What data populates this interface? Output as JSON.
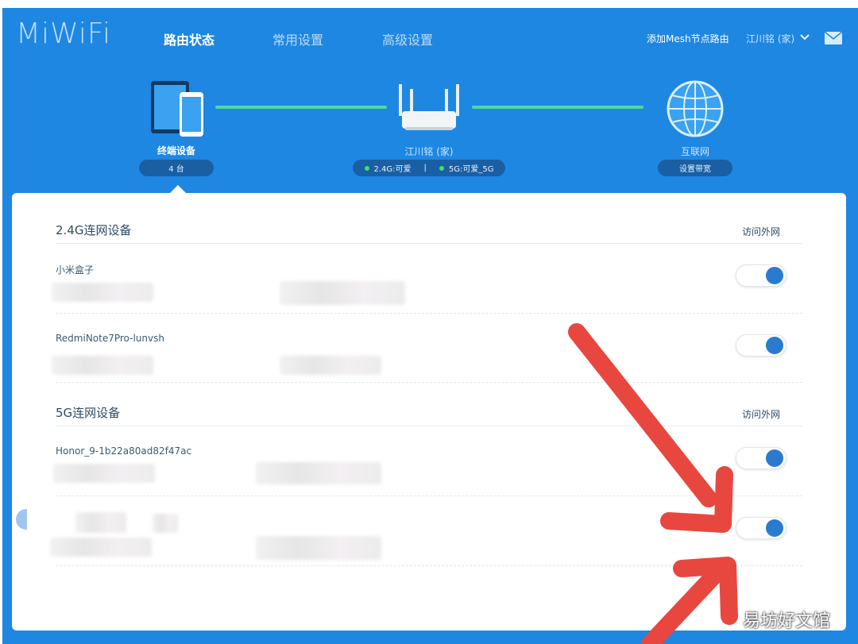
{
  "header": {
    "logo": "MiWiFi",
    "nav": [
      "路由状态",
      "常用设置",
      "高级设置"
    ],
    "add_mesh": "添加Mesh节点路由",
    "user": "江川铭 (家)",
    "icons": [
      "chevron-down-icon",
      "mail-icon"
    ]
  },
  "topology": {
    "devices_label": "终端设备",
    "devices_count": "4 台",
    "router_name": "江川铭 (家)",
    "wifi_24": "2.4G:可爱",
    "wifi_5": "5G:可爱_5G",
    "internet_label": "互联网",
    "bandwidth_button": "设置带宽"
  },
  "sections": [
    {
      "title": "2.4G连网设备",
      "right_label": "访问外网",
      "devices": [
        {
          "name": "小米盒子",
          "internet_on": true
        },
        {
          "name": "RedmiNote7Pro-lunvsh",
          "internet_on": true
        }
      ]
    },
    {
      "title": "5G连网设备",
      "right_label": "访问外网",
      "devices": [
        {
          "name": "Honor_9-1b22a80ad82f47ac",
          "internet_on": true
        },
        {
          "name": "",
          "internet_on": true
        }
      ]
    }
  ],
  "watermark": "易坊好文馆",
  "colors": {
    "header_bg": "#1e87e2",
    "link_line": "#4dd8a6",
    "toggle_knob": "#2a7bd0",
    "arrow": "#e8473f"
  }
}
